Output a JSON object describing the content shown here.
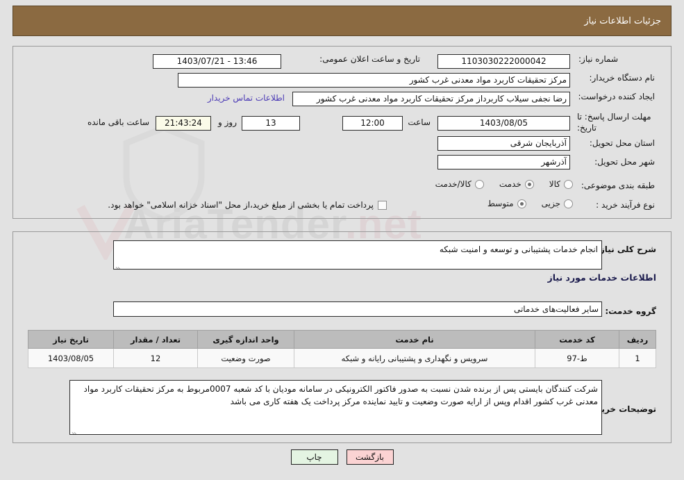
{
  "header": {
    "title": "جزئیات اطلاعات نیاز"
  },
  "main": {
    "need_number_label": "شماره نیاز:",
    "need_number_value": "1103030222000042",
    "public_announce_label": "تاریخ و ساعت اعلان عمومی:",
    "public_announce_value": "13:46 - 1403/07/21",
    "buyer_org_label": "نام دستگاه خریدار:",
    "buyer_org_value": "مرکز تحقیقات کاربرد مواد معدنی غرب کشور",
    "creator_label": "ایجاد کننده درخواست:",
    "creator_value": "رضا نجفی سیلاب کاربرداز مرکز تحقیقات کاربرد مواد معدنی غرب کشور",
    "contact_link": "اطلاعات تماس خریدار",
    "deadline_label": "مهلت ارسال پاسخ: تا تاریخ:",
    "deadline_date": "1403/08/05",
    "hour_label": "ساعت",
    "hour_value": "12:00",
    "days_value": "13",
    "days_unit": "روز و",
    "countdown_value": "21:43:24",
    "countdown_suffix": "ساعت باقی مانده",
    "province_label": "استان محل تحویل:",
    "province_value": "آذربایجان شرقی",
    "city_label": "شهر محل تحویل:",
    "city_value": "آذرشهر",
    "category_label": "طبقه بندی موضوعی:",
    "category_options": [
      {
        "label": "کالا",
        "selected": false
      },
      {
        "label": "خدمت",
        "selected": true
      },
      {
        "label": "کالا/خدمت",
        "selected": false
      }
    ],
    "process_label": "نوع فرآیند خرید :",
    "process_options": [
      {
        "label": "جزیی",
        "selected": false
      },
      {
        "label": "متوسط",
        "selected": true
      }
    ],
    "treasury_checkbox_label": "پرداخت تمام یا بخشی از مبلغ خرید،از محل \"اسناد خزانه اسلامی\" خواهد بود.",
    "treasury_checked": false
  },
  "description": {
    "need_summary_label": "شرح کلی نیاز:",
    "need_summary_value": "انجام خدمات پشتیبانی و توسعه و امنیت شبکه",
    "services_heading": "اطلاعات خدمات مورد نیاز",
    "service_group_label": "گروه خدمت:",
    "service_group_value": "سایر فعالیت‌های خدماتی",
    "buyer_notes_label": "توضیحات خریدار:",
    "buyer_notes_value": "شرکت کنندگان بایستی پس از برنده شدن نسبت به صدور فاکتور الکترونیکی در سامانه مودیان با کد شعبه 0007مربوط به مرکز تحقیقات کاربرد مواد معدنی غرب کشور اقدام وپس از ارایه صورت وضعیت و تایید نماینده مرکز پرداخت یک هفته کاری می باشد"
  },
  "table": {
    "headers": [
      "ردیف",
      "کد خدمت",
      "نام خدمت",
      "واحد اندازه گیری",
      "تعداد / مقدار",
      "تاریخ نیاز"
    ],
    "rows": [
      {
        "index": "1",
        "code": "ط-97",
        "name": "سرویس و نگهداری و پشتیبانی رایانه و شبکه",
        "unit": "صورت وضعیت",
        "quantity": "12",
        "date": "1403/08/05"
      }
    ]
  },
  "footer": {
    "print_label": "چاپ",
    "back_label": "بازگشت"
  },
  "watermark": {
    "text_left": "AriaTender",
    "text_right": ".net"
  },
  "colors": {
    "header_bg": "#8b6a41",
    "page_bg": "#e2e2e2",
    "link": "#4b3ab5",
    "table_header_bg": "#bcbcbc",
    "print_btn_bg": "#e4f4e2",
    "back_btn_bg": "#fbd3d3",
    "cream_field_bg": "#fbfbe9"
  }
}
